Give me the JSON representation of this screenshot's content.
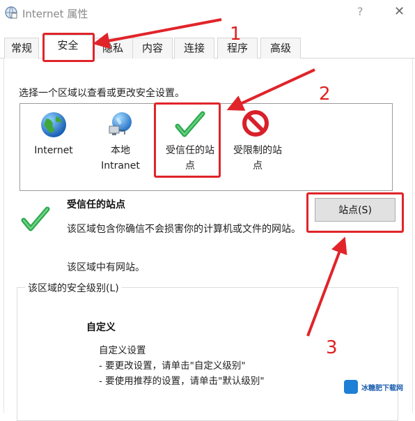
{
  "window": {
    "title": "Internet 属性",
    "help": "?",
    "close": "✕"
  },
  "tabs": [
    {
      "label": "常规",
      "active": false
    },
    {
      "label": "安全",
      "active": true
    },
    {
      "label": "隐私",
      "active": false
    },
    {
      "label": "内容",
      "active": false
    },
    {
      "label": "连接",
      "active": false
    },
    {
      "label": "程序",
      "active": false
    },
    {
      "label": "高级",
      "active": false
    }
  ],
  "security": {
    "instruction": "选择一个区域以查看或更改安全设置。",
    "zones": [
      {
        "line1": "Internet",
        "line2": "",
        "icon": "globe-icon"
      },
      {
        "line1": "本地",
        "line2": "Intranet",
        "icon": "network-globe-icon"
      },
      {
        "line1": "受信任的站",
        "line2": "点",
        "icon": "checkmark-icon"
      },
      {
        "line1": "受限制的站",
        "line2": "点",
        "icon": "prohibited-icon"
      }
    ],
    "selected_zone": {
      "title": "受信任的站点",
      "description": "该区域包含你确信不会损害你的计算机或文件的网站。",
      "status": "该区域中有网站。",
      "sites_button": "站点(S)"
    },
    "level_group": {
      "title": "该区域的安全级别(L)",
      "level_name": "自定义",
      "line1": "自定义设置",
      "line2": "- 要更改设置，请单击\"自定义级别\"",
      "line3": "- 要使用推荐的设置，请单击\"默认级别\""
    }
  },
  "annotations": {
    "step1": "1",
    "step2": "2",
    "step3": "3",
    "color": "#e0242a"
  },
  "watermark": {
    "text": "冰糖肥下载网"
  }
}
